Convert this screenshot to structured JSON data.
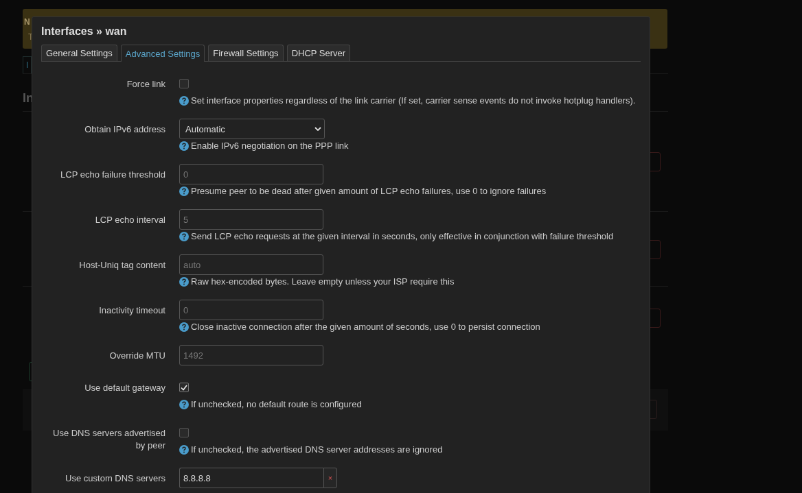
{
  "background": {
    "alert_title": "N",
    "alert_text": "T",
    "breadcrumb": "I",
    "heading": "In"
  },
  "dialog": {
    "title": "Interfaces » wan"
  },
  "tabs": [
    {
      "label": "General Settings",
      "selected": false
    },
    {
      "label": "Advanced Settings",
      "selected": true
    },
    {
      "label": "Firewall Settings",
      "selected": false
    },
    {
      "label": "DHCP Server",
      "selected": false
    }
  ],
  "fields": [
    {
      "kind": "checkbox",
      "label": "Force link",
      "checked": false,
      "help": "Set interface properties regardless of the link carrier (If set, carrier sense events do not invoke hotplug handlers)."
    },
    {
      "kind": "select",
      "label": "Obtain IPv6 address",
      "value": "Automatic",
      "help": "Enable IPv6 negotiation on the PPP link"
    },
    {
      "kind": "text",
      "label": "LCP echo failure threshold",
      "placeholder": "0",
      "help": "Presume peer to be dead after given amount of LCP echo failures, use 0 to ignore failures"
    },
    {
      "kind": "text",
      "label": "LCP echo interval",
      "placeholder": "5",
      "help": "Send LCP echo requests at the given interval in seconds, only effective in conjunction with failure threshold"
    },
    {
      "kind": "text",
      "label": "Host-Uniq tag content",
      "placeholder": "auto",
      "help": "Raw hex-encoded bytes. Leave empty unless your ISP require this"
    },
    {
      "kind": "text",
      "label": "Inactivity timeout",
      "placeholder": "0",
      "help": "Close inactive connection after the given amount of seconds, use 0 to persist connection"
    },
    {
      "kind": "text",
      "label": "Override MTU",
      "placeholder": "1492"
    },
    {
      "kind": "checkbox",
      "label": "Use default gateway",
      "checked": true,
      "help": "If unchecked, no default route is configured"
    },
    {
      "kind": "checkbox",
      "label": "Use DNS servers advertised by peer",
      "checked": false,
      "help": "If unchecked, the advertised DNS server addresses are ignored"
    },
    {
      "kind": "list",
      "label": "Use custom DNS servers",
      "value": "8.8.8.8",
      "remove": "×"
    }
  ]
}
